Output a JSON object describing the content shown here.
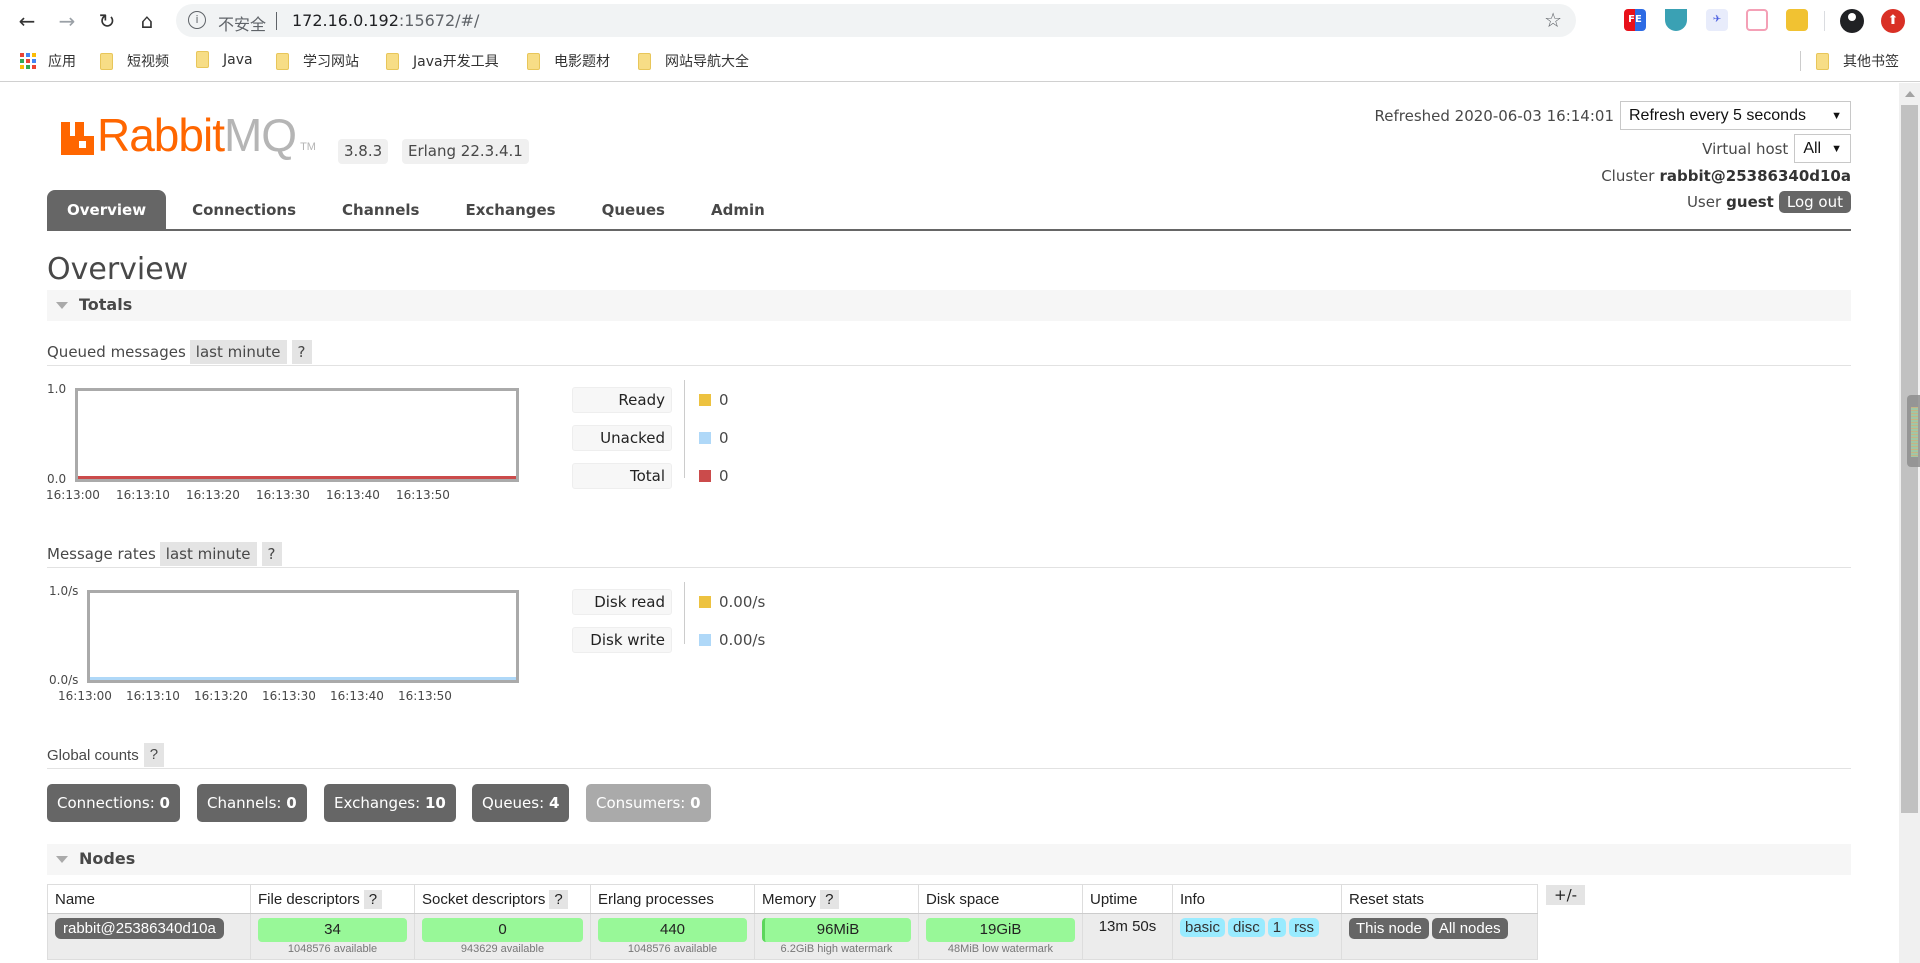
{
  "browser": {
    "insecure_label": "不安全",
    "url_host": "172.16.0.192",
    "url_rest": ":15672/#/",
    "bookmarks": [
      {
        "label": "应用",
        "icon": "apps-grid-icon"
      },
      {
        "label": "短视频",
        "icon": "folder-icon"
      },
      {
        "label": "Java",
        "icon": "folder-icon"
      },
      {
        "label": "学习网站",
        "icon": "folder-icon"
      },
      {
        "label": "Java开发工具",
        "icon": "folder-icon"
      },
      {
        "label": "电影题材",
        "icon": "folder-icon"
      },
      {
        "label": "网站导航大全",
        "icon": "folder-icon"
      }
    ],
    "other_bookmarks": "其他书签",
    "extensions": [
      "FE",
      "fruit-bowl",
      "bird",
      "tv",
      "cat"
    ]
  },
  "header": {
    "logo_rabbit": "Rabbit",
    "logo_mq": "MQ",
    "logo_tm": "TM",
    "version": "3.8.3",
    "erlang": "Erlang 22.3.4.1",
    "refreshed_label": "Refreshed 2020-06-03 16:14:01",
    "refresh_select": "Refresh every 5 seconds",
    "vhost_label": "Virtual host",
    "vhost_select": "All",
    "cluster_label": "Cluster",
    "cluster_name": "rabbit@25386340d10a",
    "user_label": "User",
    "user_name": "guest",
    "logout": "Log out"
  },
  "tabs": [
    {
      "label": "Overview",
      "active": true
    },
    {
      "label": "Connections",
      "active": false
    },
    {
      "label": "Channels",
      "active": false
    },
    {
      "label": "Exchanges",
      "active": false
    },
    {
      "label": "Queues",
      "active": false
    },
    {
      "label": "Admin",
      "active": false
    }
  ],
  "page_title": "Overview",
  "totals": {
    "label": "Totals",
    "queued": {
      "title": "Queued messages",
      "range": "last minute",
      "help": "?",
      "legend": [
        {
          "label": "Ready",
          "value": "0",
          "color": "#edc240"
        },
        {
          "label": "Unacked",
          "value": "0",
          "color": "#afd8f8"
        },
        {
          "label": "Total",
          "value": "0",
          "color": "#cb4b4b"
        }
      ]
    },
    "rates": {
      "title": "Message rates",
      "range": "last minute",
      "help": "?",
      "legend": [
        {
          "label": "Disk read",
          "value": "0.00/s",
          "color": "#edc240"
        },
        {
          "label": "Disk write",
          "value": "0.00/s",
          "color": "#afd8f8"
        }
      ]
    }
  },
  "chart_data": [
    {
      "type": "line",
      "title": "Queued messages",
      "x": [
        "16:13:00",
        "16:13:10",
        "16:13:20",
        "16:13:30",
        "16:13:40",
        "16:13:50"
      ],
      "ylim": [
        0,
        1.0
      ],
      "y_ticks": [
        "0.0",
        "1.0"
      ],
      "series": [
        {
          "name": "Ready",
          "values": [
            0,
            0,
            0,
            0,
            0,
            0
          ]
        },
        {
          "name": "Unacked",
          "values": [
            0,
            0,
            0,
            0,
            0,
            0
          ]
        },
        {
          "name": "Total",
          "values": [
            0,
            0,
            0,
            0,
            0,
            0
          ]
        }
      ]
    },
    {
      "type": "line",
      "title": "Message rates",
      "x": [
        "16:13:00",
        "16:13:10",
        "16:13:20",
        "16:13:30",
        "16:13:40",
        "16:13:50"
      ],
      "ylim": [
        0,
        1.0
      ],
      "y_ticks": [
        "0.0/s",
        "1.0/s"
      ],
      "series": [
        {
          "name": "Disk read",
          "values": [
            0,
            0,
            0,
            0,
            0,
            0
          ]
        },
        {
          "name": "Disk write",
          "values": [
            0,
            0,
            0,
            0,
            0,
            0
          ]
        }
      ]
    }
  ],
  "global_counts": {
    "title": "Global counts",
    "help": "?",
    "items": [
      {
        "label": "Connections:",
        "value": "0"
      },
      {
        "label": "Channels:",
        "value": "0"
      },
      {
        "label": "Exchanges:",
        "value": "10"
      },
      {
        "label": "Queues:",
        "value": "4"
      },
      {
        "label": "Consumers:",
        "value": "0"
      }
    ]
  },
  "nodes": {
    "label": "Nodes",
    "columns": [
      "Name",
      "File descriptors",
      "Socket descriptors",
      "Erlang processes",
      "Memory",
      "Disk space",
      "Uptime",
      "Info",
      "Reset stats"
    ],
    "help": "?",
    "toggle": "+/-",
    "rows": [
      {
        "name": "rabbit@25386340d10a",
        "file_descriptors": {
          "value": "34",
          "sub": "1048576 available"
        },
        "socket_descriptors": {
          "value": "0",
          "sub": "943629 available"
        },
        "erlang_processes": {
          "value": "440",
          "sub": "1048576 available"
        },
        "memory": {
          "value": "96MiB",
          "sub": "6.2GiB high watermark"
        },
        "disk_space": {
          "value": "19GiB",
          "sub": "48MiB low watermark"
        },
        "uptime": "13m 50s",
        "info": [
          "basic",
          "disc",
          "1",
          "rss"
        ],
        "reset": [
          "This node",
          "All nodes"
        ]
      }
    ]
  }
}
